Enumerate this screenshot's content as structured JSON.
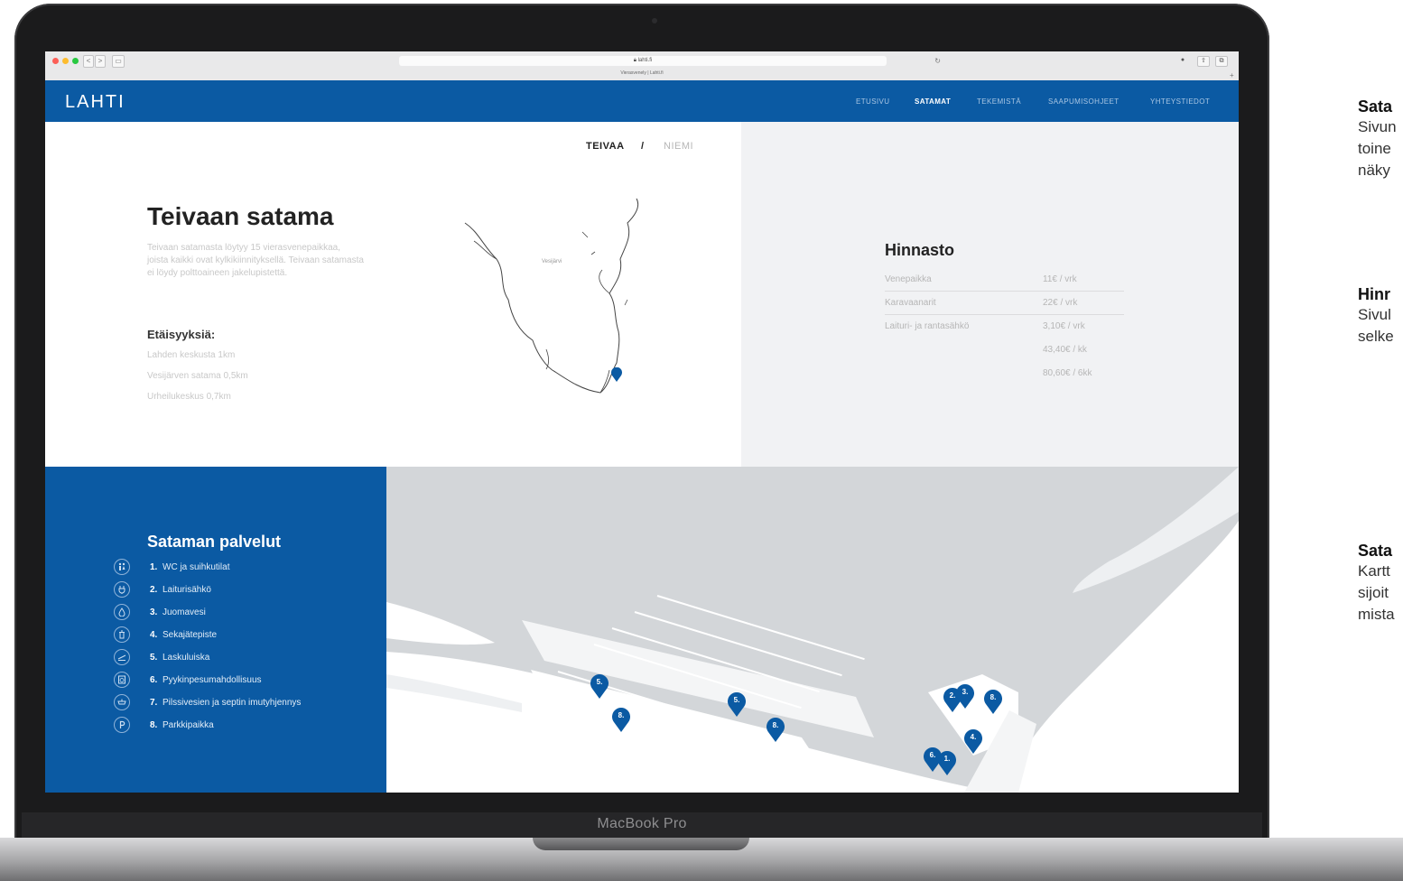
{
  "device": {
    "label": "MacBook Pro"
  },
  "browser": {
    "url": "lahti.fi",
    "tab_title": "Vierasvenely | Lahti.fi",
    "back": "<",
    "forward": ">",
    "sidebar": "▭",
    "reload": "↻",
    "ext1": "●",
    "share": "⇧",
    "tabs_btn": "⧉",
    "add": "+"
  },
  "header": {
    "logo": "LAHTI",
    "nav": [
      "ETUSIVU",
      "SATAMAT",
      "TEKEMISTÄ",
      "SAAPUMISOHJEET",
      "YHTEYSTIEDOT"
    ],
    "active_nav": "SATAMAT"
  },
  "harbor_tabs": {
    "active": "TEIVAA",
    "separator": "/",
    "other": "NIEMI"
  },
  "harbor": {
    "title": "Teivaan satama",
    "description": "Teivaan satamasta löytyy 15 vierasvenepaikkaa, joista kaikki ovat kylkikiinnityksellä. Teivaan satamasta ei löydy polttoaineen jakelupistettä.",
    "distances_title": "Etäisyyksiä:",
    "distances": [
      "Lahden keskusta 1km",
      "Vesijärven satama 0,5km",
      "Urheilukeskus 0,7km"
    ],
    "map_label": "Vesijärvi"
  },
  "prices": {
    "title": "Hinnasto",
    "rows": [
      {
        "label": "Venepaikka",
        "value": "11€ / vrk"
      },
      {
        "label": "Karavaanarit",
        "value": "22€ / vrk"
      },
      {
        "label": "Laituri- ja rantasähkö",
        "value": "3,10€ / vrk"
      },
      {
        "label": "",
        "value": "43,40€ / kk"
      },
      {
        "label": "",
        "value": "80,60€ / 6kk"
      }
    ]
  },
  "services": {
    "title": "Sataman palvelut",
    "items": [
      {
        "num": "1.",
        "label": "WC ja suihkutilat",
        "icon": "wc-icon"
      },
      {
        "num": "2.",
        "label": "Laiturisähkö",
        "icon": "power-icon"
      },
      {
        "num": "3.",
        "label": "Juomavesi",
        "icon": "water-drop-icon"
      },
      {
        "num": "4.",
        "label": "Sekajätepiste",
        "icon": "trash-icon"
      },
      {
        "num": "5.",
        "label": "Laskuluiska",
        "icon": "boat-ramp-icon"
      },
      {
        "num": "6.",
        "label": "Pyykinpesumahdollisuus",
        "icon": "laundry-icon"
      },
      {
        "num": "7.",
        "label": "Pilssivesien ja septin imutyhjennys",
        "icon": "pump-icon"
      },
      {
        "num": "8.",
        "label": "Parkkipaikka",
        "icon": "parking-icon"
      }
    ]
  },
  "map_pins": [
    "5.",
    "8.",
    "5.",
    "8.",
    "2.",
    "3.",
    "8.",
    "4.",
    "6.",
    "1."
  ],
  "side_notes": [
    {
      "title": "Sata",
      "lines": [
        "Sivun",
        "toine",
        "näky"
      ]
    },
    {
      "title": "Hinr",
      "lines": [
        "Sivul",
        "selke"
      ]
    },
    {
      "title": "Sata",
      "lines": [
        "Kartt",
        "sijoit",
        "mista"
      ]
    }
  ],
  "colors": {
    "brand_blue": "#0b5aa3",
    "grey_panel": "#f1f2f4",
    "map_land": "#ffffff",
    "map_water": "#d3d6d9"
  }
}
